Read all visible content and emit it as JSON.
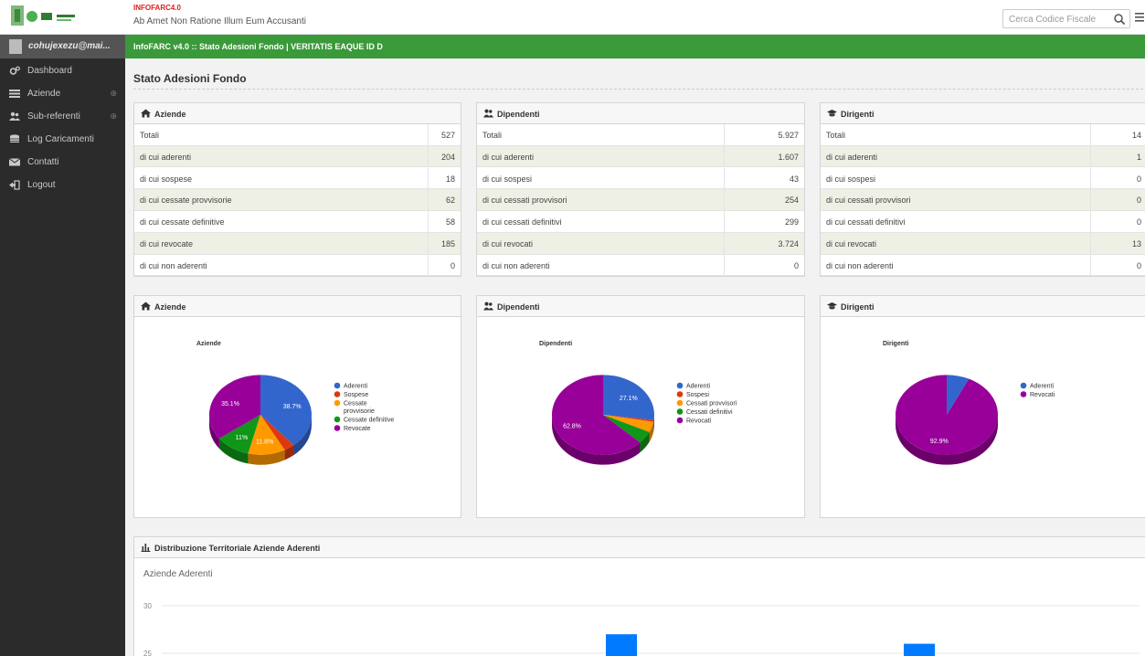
{
  "header": {
    "brand_title": "INFOFARC4.0",
    "brand_subtitle": "Ab Amet Non Ratione Illum Eum Accusanti",
    "search_placeholder": "Cerca Codice Fiscale"
  },
  "sidebar": {
    "user": "cohujexezu@mai...",
    "items": [
      {
        "label": "Dashboard",
        "icon": "cogs-icon",
        "expandable": false
      },
      {
        "label": "Aziende",
        "icon": "list-icon",
        "expandable": true
      },
      {
        "label": "Sub-referenti",
        "icon": "users-icon",
        "expandable": true
      },
      {
        "label": "Log Caricamenti",
        "icon": "database-icon",
        "expandable": false
      },
      {
        "label": "Contatti",
        "icon": "envelope-icon",
        "expandable": false
      },
      {
        "label": "Logout",
        "icon": "sign-out-icon",
        "expandable": false
      }
    ]
  },
  "breadcrumb": "InfoFARC v4.0 :: Stato Adesioni Fondo | VERITATIS EAQUE ID D",
  "page_title": "Stato Adesioni Fondo",
  "stat_panels": [
    {
      "title": "Aziende",
      "icon": "home-icon",
      "rows": [
        {
          "label": "Totali",
          "value": "527"
        },
        {
          "label": "di cui aderenti",
          "value": "204"
        },
        {
          "label": "di cui sospese",
          "value": "18"
        },
        {
          "label": "di cui cessate provvisorie",
          "value": "62"
        },
        {
          "label": "di cui cessate definitive",
          "value": "58"
        },
        {
          "label": "di cui revocate",
          "value": "185"
        },
        {
          "label": "di cui non aderenti",
          "value": "0"
        }
      ]
    },
    {
      "title": "Dipendenti",
      "icon": "users-icon",
      "rows": [
        {
          "label": "Totali",
          "value": "5.927"
        },
        {
          "label": "di cui aderenti",
          "value": "1.607"
        },
        {
          "label": "di cui sospesi",
          "value": "43"
        },
        {
          "label": "di cui cessati provvisori",
          "value": "254"
        },
        {
          "label": "di cui cessati definitivi",
          "value": "299"
        },
        {
          "label": "di cui revocati",
          "value": "3.724"
        },
        {
          "label": "di cui non aderenti",
          "value": "0"
        }
      ]
    },
    {
      "title": "Dirigenti",
      "icon": "graduation-cap-icon",
      "rows": [
        {
          "label": "Totali",
          "value": "14"
        },
        {
          "label": "di cui aderenti",
          "value": "1"
        },
        {
          "label": "di cui sospesi",
          "value": "0"
        },
        {
          "label": "di cui cessati provvisori",
          "value": "0"
        },
        {
          "label": "di cui cessati definitivi",
          "value": "0"
        },
        {
          "label": "di cui revocati",
          "value": "13"
        },
        {
          "label": "di cui non aderenti",
          "value": "0"
        }
      ]
    }
  ],
  "chart_data": [
    {
      "type": "pie",
      "panel_title": "Aziende",
      "title": "Aziende",
      "labels": [
        "Aderenti",
        "Sospese",
        "Cessate provvisorie",
        "Cessate definitive",
        "Revocate"
      ],
      "values": [
        204,
        18,
        62,
        58,
        185
      ],
      "percent_labels": [
        "38.7%",
        "",
        "11.8%",
        "11%",
        "35.1%"
      ],
      "colors": [
        "#3366cc",
        "#dc3912",
        "#ff9900",
        "#109618",
        "#990099"
      ]
    },
    {
      "type": "pie",
      "panel_title": "Dipendenti",
      "title": "Dipendenti",
      "labels": [
        "Aderenti",
        "Sospesi",
        "Cessati provvisori",
        "Cessati definitivi",
        "Revocati"
      ],
      "values": [
        1607,
        43,
        254,
        299,
        3724
      ],
      "percent_labels": [
        "27.1%",
        "",
        "",
        "",
        "62.8%"
      ],
      "colors": [
        "#3366cc",
        "#dc3912",
        "#ff9900",
        "#109618",
        "#990099"
      ]
    },
    {
      "type": "pie",
      "panel_title": "Dirigenti",
      "title": "Dirigenti",
      "labels": [
        "Aderenti",
        "Revocati"
      ],
      "values": [
        1,
        13
      ],
      "percent_labels": [
        "",
        "92.9%"
      ],
      "colors": [
        "#3366cc",
        "#990099"
      ]
    },
    {
      "type": "bar",
      "panel_title": "Distribuzione Territoriale Aziende Aderenti",
      "title": "Aziende Aderenti",
      "y_ticks": [
        30,
        25
      ],
      "ylim": [
        0,
        32
      ],
      "bars_visible": [
        {
          "value": 27,
          "color": "#007bff"
        },
        {
          "value": 26,
          "color": "#007bff"
        }
      ]
    }
  ]
}
